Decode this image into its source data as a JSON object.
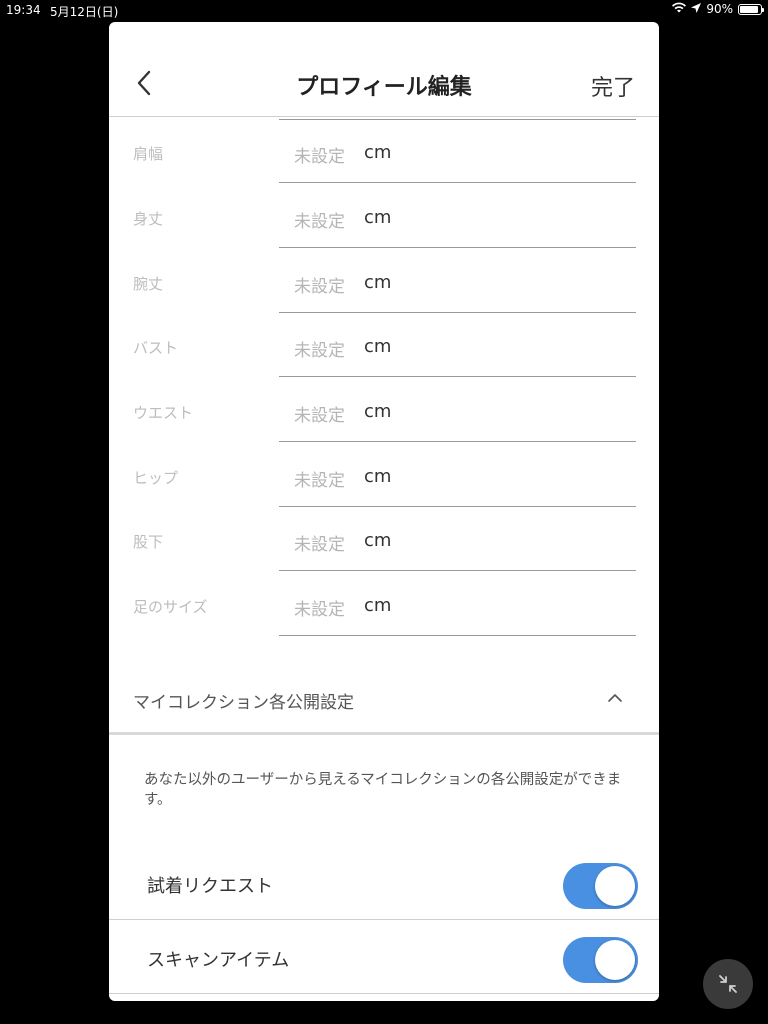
{
  "status_bar": {
    "time": "19:34",
    "date": "5月12日(日)",
    "battery": "90%"
  },
  "nav": {
    "back_icon": "chevron-left",
    "title": "プロフィール編集",
    "done": "完了"
  },
  "fields": [
    {
      "label": "肩幅",
      "value": "未設定",
      "unit": "cm"
    },
    {
      "label": "身丈",
      "value": "未設定",
      "unit": "cm"
    },
    {
      "label": "腕丈",
      "value": "未設定",
      "unit": "cm"
    },
    {
      "label": "バスト",
      "value": "未設定",
      "unit": "cm"
    },
    {
      "label": "ウエスト",
      "value": "未設定",
      "unit": "cm"
    },
    {
      "label": "ヒップ",
      "value": "未設定",
      "unit": "cm"
    },
    {
      "label": "股下",
      "value": "未設定",
      "unit": "cm"
    },
    {
      "label": "足のサイズ",
      "value": "未設定",
      "unit": "cm"
    }
  ],
  "collection_section": {
    "title": "マイコレクション各公開設定",
    "chevron": "chevron-up",
    "description": "あなた以外のユーザーから見えるマイコレクションの各公開設定ができます。",
    "toggles": [
      {
        "label": "試着リクエスト",
        "on": true
      },
      {
        "label": "スキャンアイテム",
        "on": true
      }
    ]
  },
  "colors": {
    "toggle_on": "#4a90e2",
    "text_dark": "#333333"
  },
  "fab_icon": "collapse-arrows"
}
